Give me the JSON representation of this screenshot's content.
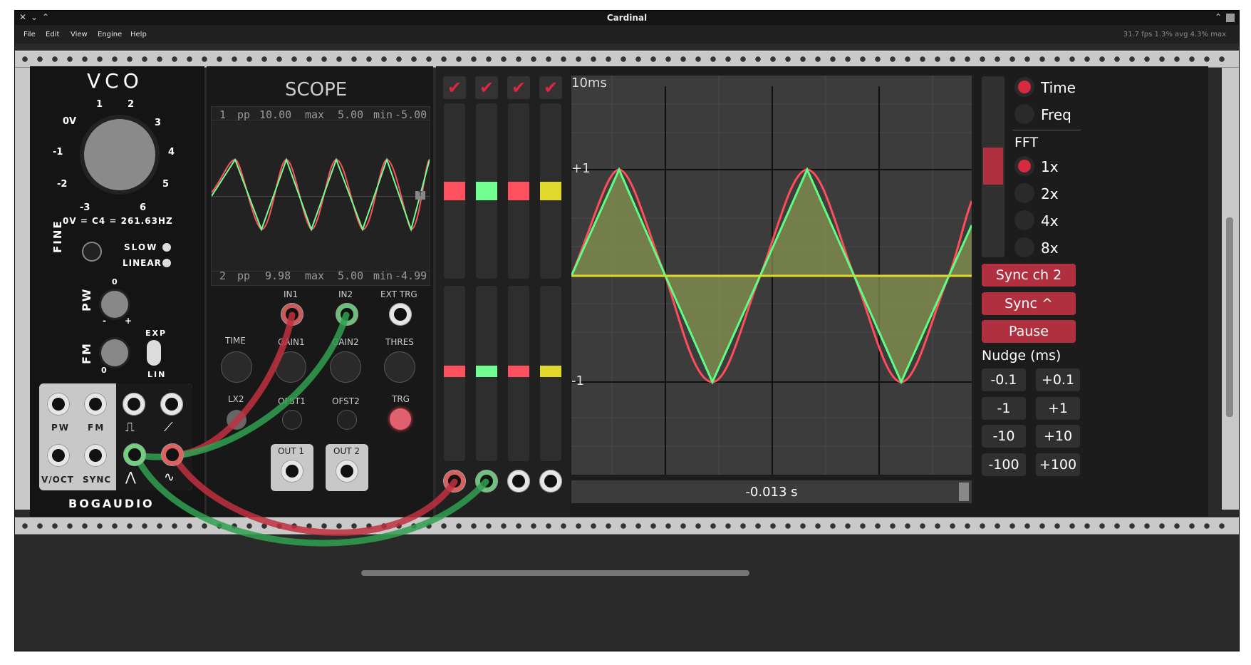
{
  "window": {
    "title": "Cardinal"
  },
  "menu": [
    "File",
    "Edit",
    "View",
    "Engine",
    "Help"
  ],
  "stats": "31.7 fps  1.3% avg  4.3% max",
  "vco": {
    "title": "VCO",
    "tuning": "0V = C4 = 261.63HZ",
    "freq_ticks": [
      "0V",
      "1",
      "2",
      "3",
      "4",
      "5",
      "6",
      "-3",
      "-2",
      "-1"
    ],
    "fine": "FINE",
    "slow": "SLOW",
    "linear": "LINEAR",
    "pw": "PW",
    "fm": "FM",
    "exp": "EXP",
    "lin": "LIN",
    "pw_zero": "0",
    "pw_minus": "-",
    "pw_plus": "+",
    "fm_zero": "0",
    "jacks": [
      "PW",
      "FM",
      "V/OCT",
      "SYNC"
    ],
    "brand": "BOGAUDIO"
  },
  "scope": {
    "title": "SCOPE",
    "ch1": {
      "num": "1",
      "pp_label": "pp",
      "pp": "10.00",
      "max_label": "max",
      "max": "5.00",
      "min_label": "min",
      "min": "-5.00"
    },
    "ch2": {
      "num": "2",
      "pp_label": "pp",
      "pp": "9.98",
      "max_label": "max",
      "max": "5.00",
      "min_label": "min",
      "min": "-4.99"
    },
    "trigger_marker": "T",
    "labels": {
      "in1": "IN1",
      "in2": "IN2",
      "ext_trg": "EXT TRG",
      "time": "TIME",
      "gain1": "GAIN1",
      "gain2": "GAIN2",
      "thres": "THRES",
      "lx2": "LX2",
      "ofst1": "OFST1",
      "ofst2": "OFST2",
      "trg": "TRG",
      "out1": "OUT 1",
      "out2": "OUT 2"
    }
  },
  "colors": {
    "red": "#ff4d5a",
    "green": "#5cff84",
    "yellow": "#e0d82a",
    "accent": "#b03040",
    "panel": "#121212"
  },
  "display": {
    "timebase": "10ms",
    "plus_one": "+1",
    "minus_one": "-1",
    "readout": "-0.013 s"
  },
  "controls": {
    "time": "Time",
    "freq": "Freq",
    "fft": "FFT",
    "fft_options": [
      "1x",
      "2x",
      "4x",
      "8x"
    ],
    "sync_ch2": "Sync ch 2",
    "sync": "Sync ^",
    "pause": "Pause",
    "nudge": "Nudge (ms)",
    "nudge_buttons": [
      [
        "-0.1",
        "+0.1"
      ],
      [
        "-1",
        "+1"
      ],
      [
        "-10",
        "+10"
      ],
      [
        "-100",
        "+100"
      ]
    ]
  }
}
